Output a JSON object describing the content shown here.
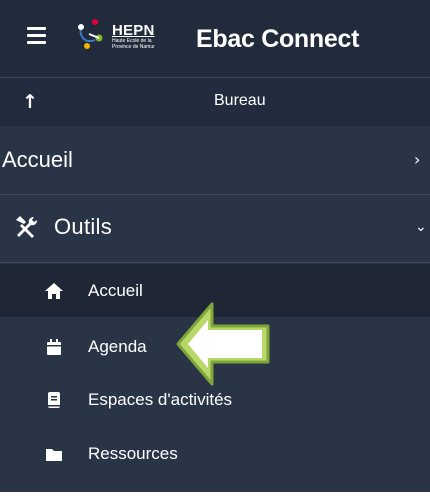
{
  "header": {
    "logo_text": "HEPN",
    "logo_sub": "Haute Ecole de la Province de Namur",
    "app_title": "Ebac Connect"
  },
  "breadcrumb": {
    "label": "Bureau"
  },
  "nav": {
    "accueil": {
      "label": "Accueil"
    },
    "outils": {
      "label": "Outils",
      "items": [
        {
          "label": "Accueil",
          "icon": "home-icon"
        },
        {
          "label": "Agenda",
          "icon": "calendar-icon"
        },
        {
          "label": "Espaces d'activités",
          "icon": "book-icon"
        },
        {
          "label": "Ressources",
          "icon": "folder-icon"
        }
      ]
    }
  },
  "colors": {
    "panel_bg": "#2a3447",
    "header_bg": "#222b3c",
    "active_bg": "#1f2736",
    "callout_arrow": "#b8d86a",
    "callout_arrow_border": "#7ea63a"
  }
}
